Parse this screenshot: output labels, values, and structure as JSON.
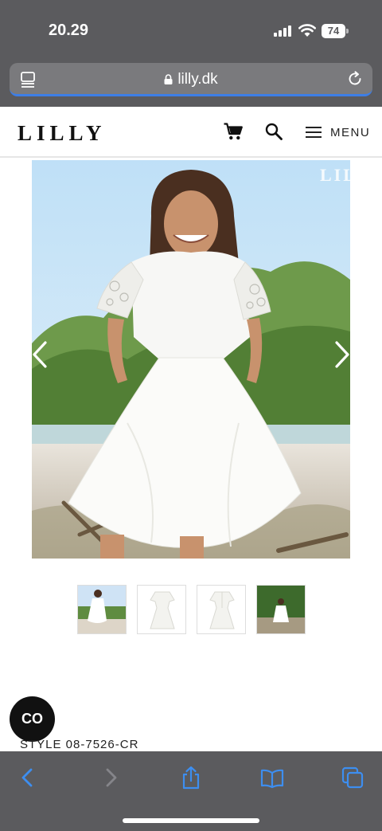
{
  "status_bar": {
    "time": "20.29",
    "battery": "74"
  },
  "browser": {
    "url": "lilly.dk"
  },
  "header": {
    "logo": "LILLY",
    "menu_label": "MENU"
  },
  "hero": {
    "watermark": "LILI"
  },
  "thumbnails": [
    {
      "name": "thumbnail-model-beach",
      "selected": true
    },
    {
      "name": "thumbnail-dress-front"
    },
    {
      "name": "thumbnail-dress-back"
    },
    {
      "name": "thumbnail-model-garden"
    }
  ],
  "product": {
    "style_label": "STYLE 08-7526-CR"
  },
  "badge": {
    "text": "CO"
  },
  "colors": {
    "chrome": "#5b5b5e",
    "accent_blue": "#3d7ee6",
    "icon_blue": "#3d8ef0"
  }
}
